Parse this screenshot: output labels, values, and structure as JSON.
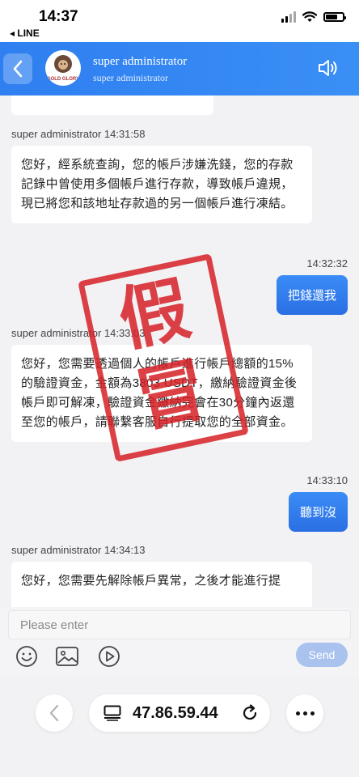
{
  "status_bar": {
    "time": "14:37",
    "back_app": "◂ LINE"
  },
  "header": {
    "name": "super administrator",
    "subtitle": "super administrator",
    "avatar_text": "GOLD GLORY"
  },
  "messages": [
    {
      "type": "incoming",
      "sender_line": "super administrator 14:31:58",
      "text": "您好，經系統查詢，您的帳戶涉嫌洗錢，您的存款記錄中曾使用多個帳戶進行存款，導致帳戶違規，現已將您和該地址存款過的另一個帳戶進行凍結。"
    },
    {
      "type": "outgoing",
      "time": "14:32:32",
      "text": "把錢還我"
    },
    {
      "type": "incoming",
      "sender_line": "super administrator 14:33:03",
      "text": "您好，您需要透過個人的帳戶進行帳戶總額的15%的驗證資金，金額為3803 USDT，繳納驗證資金後帳戶即可解凍，驗證資金繳納完會在30分鐘內返還至您的帳戶，請聯繫客服自行提取您的全部資金。"
    },
    {
      "type": "outgoing",
      "time": "14:33:10",
      "text": "聽到沒"
    },
    {
      "type": "incoming",
      "sender_line": "super administrator 14:34:13",
      "text": "您好，您需要先解除帳戶異常，之後才能進行提"
    }
  ],
  "stamp_text": [
    "假",
    "冒"
  ],
  "input": {
    "placeholder": "Please enter",
    "send_label": "Send"
  },
  "browser": {
    "url": "47.86.59.44"
  }
}
